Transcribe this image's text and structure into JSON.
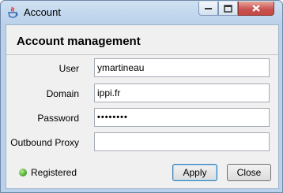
{
  "window": {
    "title": "Account",
    "icon": "java-cup-icon"
  },
  "heading": "Account management",
  "form": {
    "user_label": "User",
    "user_value": "ymartineau",
    "domain_label": "Domain",
    "domain_value": "ippi.fr",
    "password_label": "Password",
    "password_value": "••••••••",
    "proxy_label": "Outbound Proxy",
    "proxy_value": ""
  },
  "status": {
    "text": "Registered",
    "color": "#3ea12c"
  },
  "buttons": {
    "apply": "Apply",
    "close": "Close"
  }
}
